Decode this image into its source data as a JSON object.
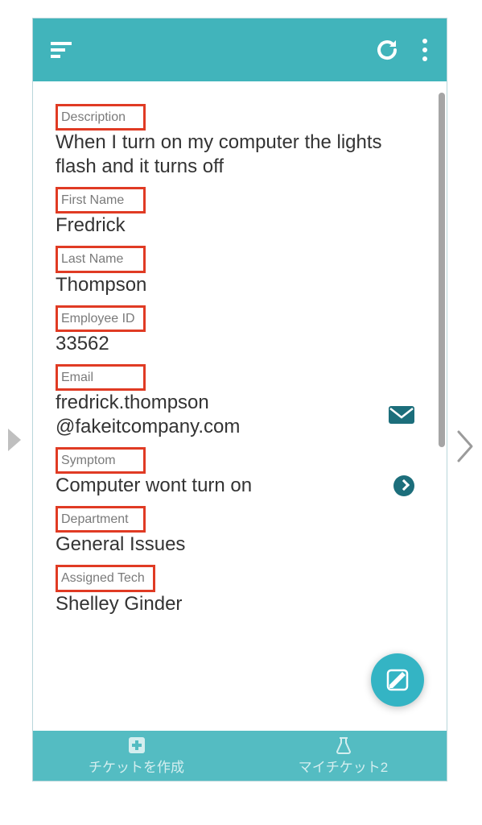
{
  "fields": {
    "description": {
      "label": "Description",
      "value": "When I turn on my computer the lights flash and it turns off"
    },
    "first_name": {
      "label": "First Name",
      "value": "Fredrick"
    },
    "last_name": {
      "label": "Last Name",
      "value": "Thompson"
    },
    "employee_id": {
      "label": "Employee ID",
      "value": "33562"
    },
    "email": {
      "label": "Email",
      "value": "fredrick.thompson @fakeitcompany.com"
    },
    "symptom": {
      "label": "Symptom",
      "value": "Computer wont turn on"
    },
    "department": {
      "label": "Department",
      "value": "General Issues"
    },
    "assigned_tech": {
      "label": "Assigned Tech",
      "value": "Shelley Ginder"
    }
  },
  "bottom": {
    "create": "チケットを作成",
    "mytickets": "マイチケット2"
  }
}
